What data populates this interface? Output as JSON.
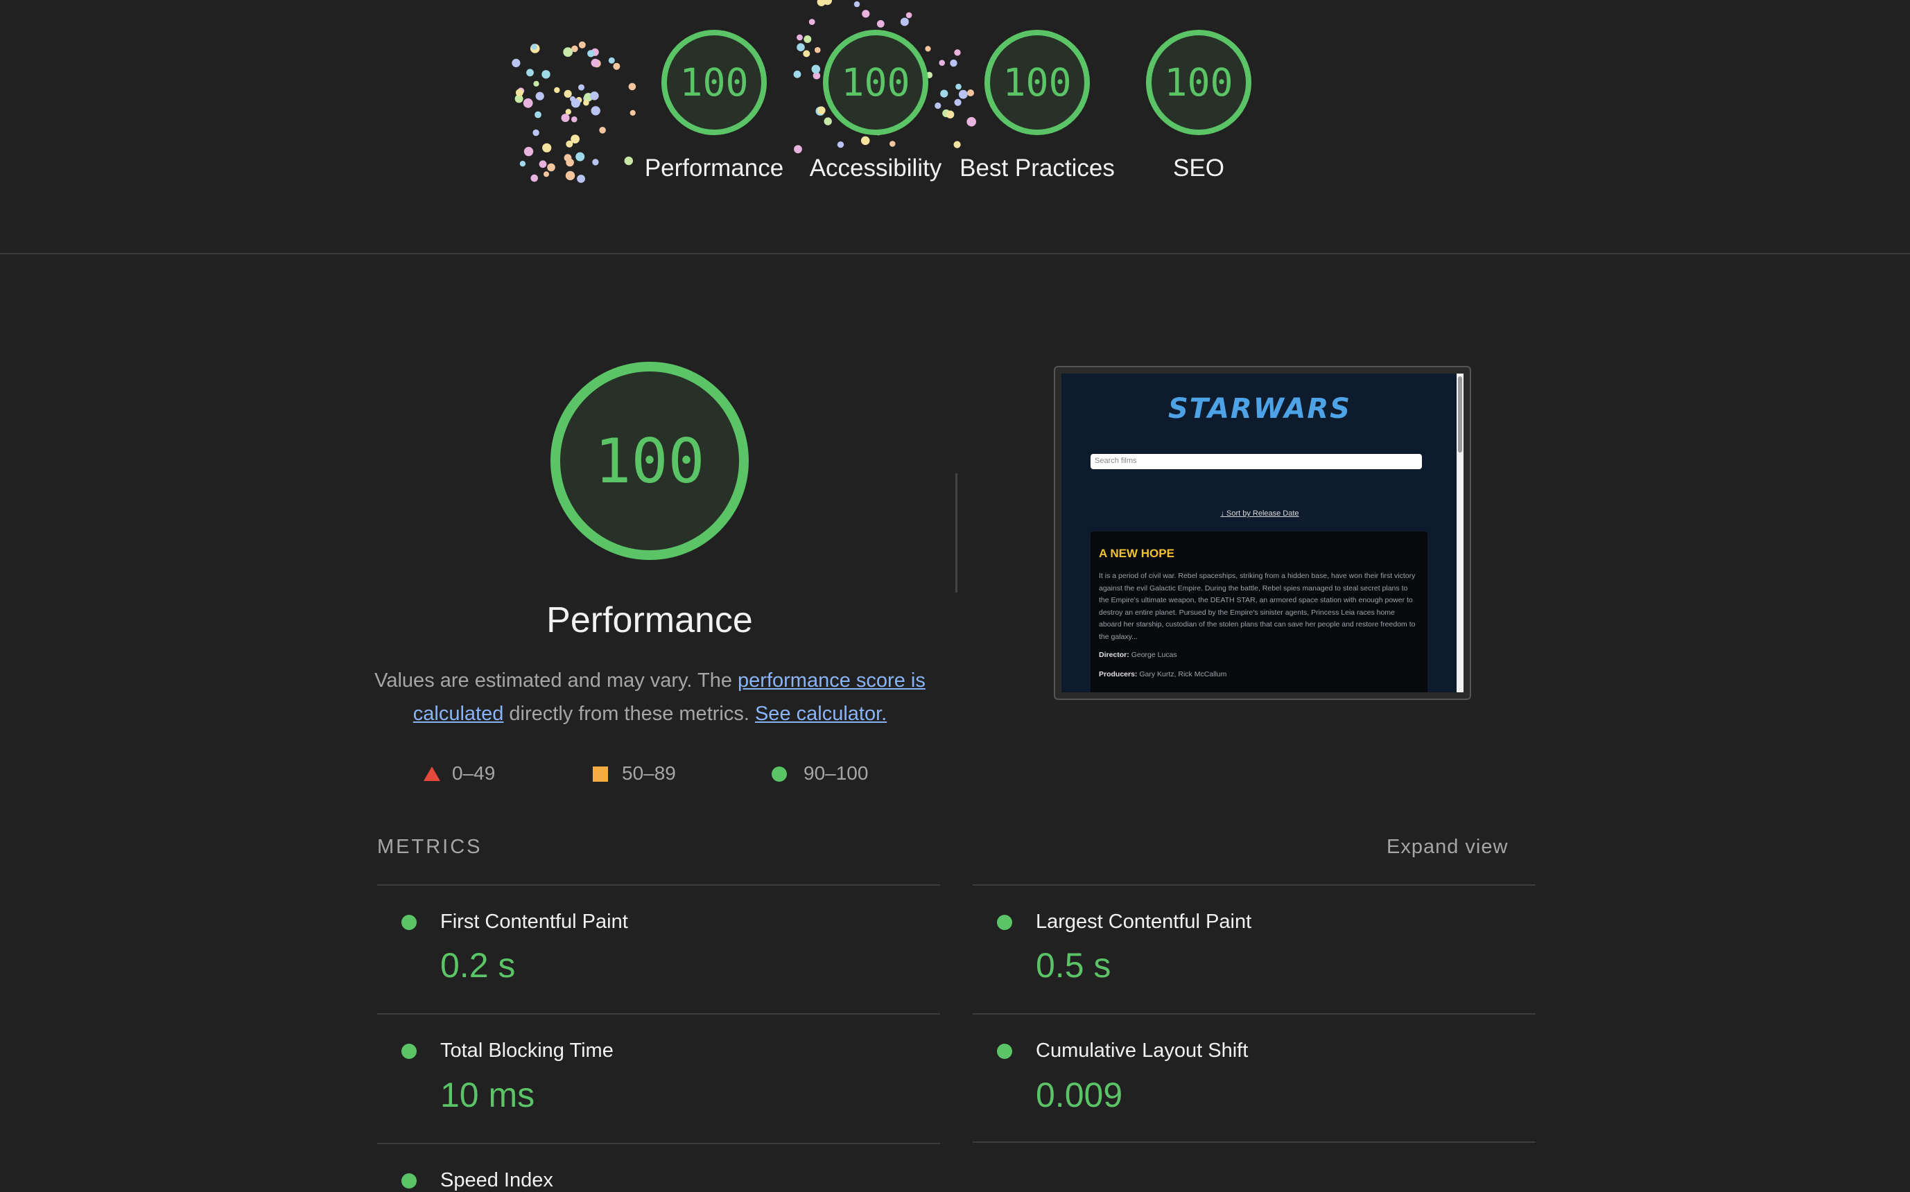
{
  "categories": [
    {
      "score": "100",
      "label": "Performance"
    },
    {
      "score": "100",
      "label": "Accessibility"
    },
    {
      "score": "100",
      "label": "Best Practices"
    },
    {
      "score": "100",
      "label": "SEO"
    }
  ],
  "performance": {
    "score": "100",
    "title": "Performance",
    "desc_pre": "Values are estimated and may vary. The ",
    "desc_link1": "performance score is calculated",
    "desc_mid": " directly from these metrics. ",
    "desc_link2": "See calculator."
  },
  "legend": [
    {
      "range": "0–49",
      "color": "#e5493a"
    },
    {
      "range": "50–89",
      "color": "#f4ad42"
    },
    {
      "range": "90–100",
      "color": "#5ac466"
    }
  ],
  "screenshot": {
    "logo": "STARWARS",
    "search_placeholder": "Search films",
    "sort_link": "↓ Sort by Release Date",
    "film_title": "A NEW HOPE",
    "crawl": "It is a period of civil war. Rebel spaceships, striking from a hidden base, have won their first victory against the evil Galactic Empire. During the battle, Rebel spies managed to steal secret plans to the Empire's ultimate weapon, the DEATH STAR, an armored space station with enough power to destroy an entire planet. Pursued by the Empire's sinister agents, Princess Leia races home aboard her starship, custodian of the stolen plans that can save her people and restore freedom to the galaxy...",
    "director_label": "Director:",
    "director": "George Lucas",
    "producers_label": "Producers:",
    "producers": "Gary Kurtz, Rick McCallum"
  },
  "metrics": {
    "header": "METRICS",
    "expand": "Expand view",
    "items": [
      {
        "name": "First Contentful Paint",
        "value": "0.2 s"
      },
      {
        "name": "Largest Contentful Paint",
        "value": "0.5 s"
      },
      {
        "name": "Total Blocking Time",
        "value": "10 ms"
      },
      {
        "name": "Cumulative Layout Shift",
        "value": "0.009"
      },
      {
        "name": "Speed Index",
        "value": ""
      }
    ]
  },
  "colors": {
    "pass": "#5ac466",
    "background": "#212121"
  }
}
